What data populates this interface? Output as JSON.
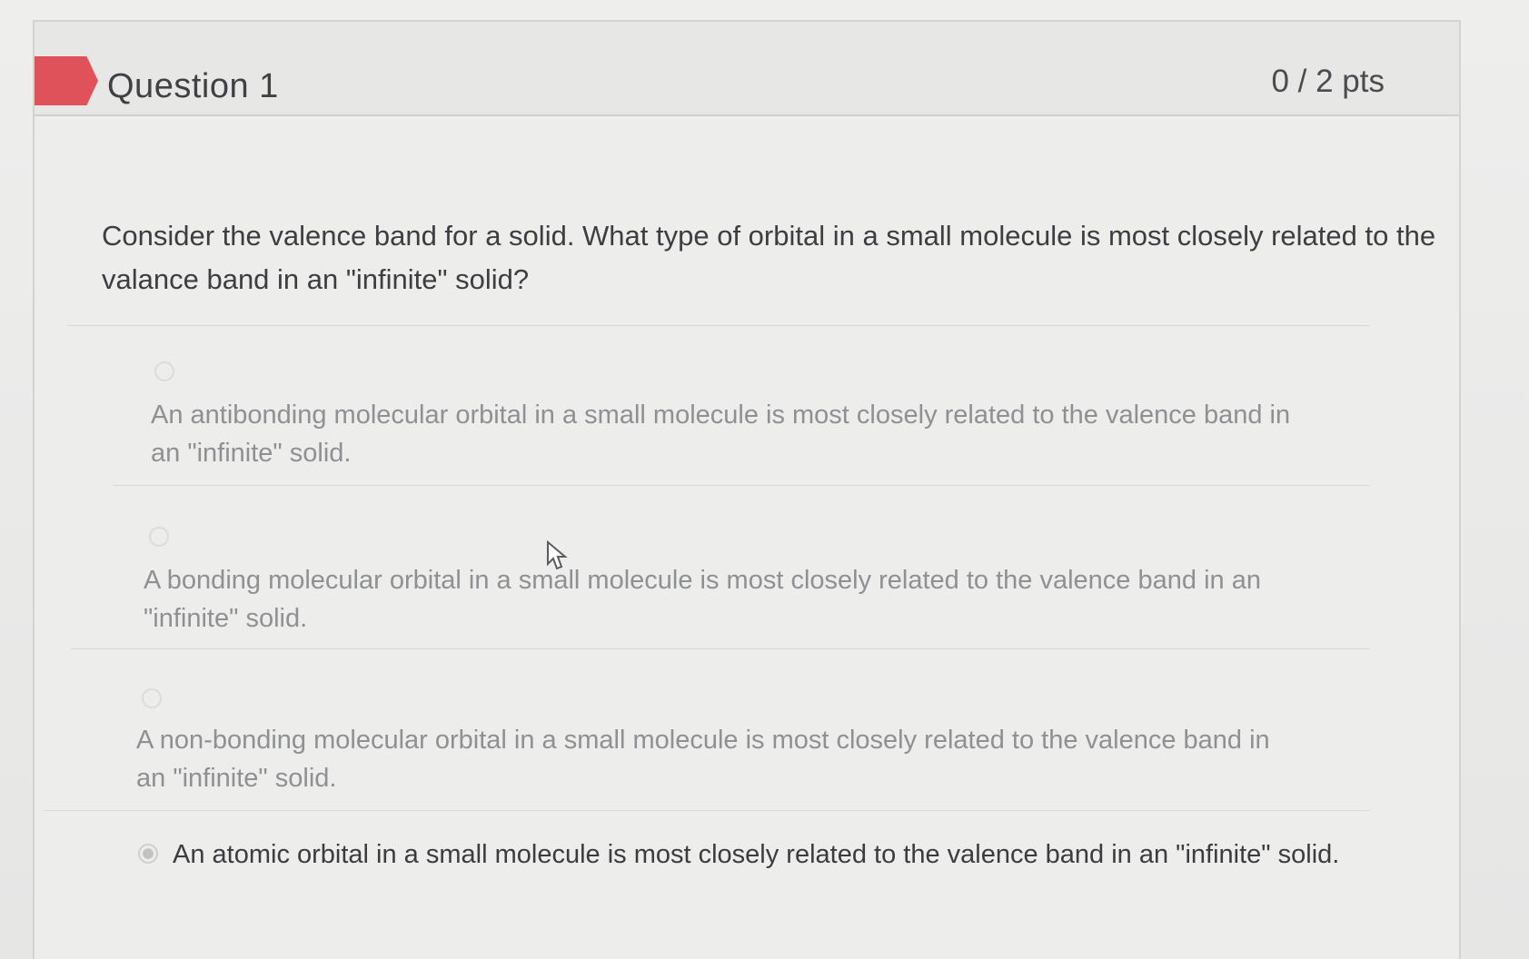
{
  "question": {
    "title": "Question 1",
    "points": "0 / 2 pts",
    "prompt": "Consider the valence band for a solid. What type of orbital in a small molecule is most closely related to the valance band in an \"infinite\" solid?"
  },
  "answers": [
    {
      "label": "An antibonding molecular orbital in a small molecule is most closely related to the valence band in an \"infinite\" solid.",
      "selected": false
    },
    {
      "label": "A bonding molecular orbital in a small molecule is most closely related to the valence band in an \"infinite\" solid.",
      "selected": false
    },
    {
      "label": "A non-bonding molecular orbital in a small molecule is most closely related to the valence band in an \"infinite\" solid.",
      "selected": false
    },
    {
      "label": "An atomic orbital in a small molecule is most closely related to the valence band in an \"infinite\" solid.",
      "selected": true
    }
  ],
  "colors": {
    "flag": "#e05259",
    "background": "#ededec",
    "header": "#e7e7e6",
    "question_text": "#3c3e41",
    "unselected_answer_text": "#8e9093"
  },
  "icons": {
    "flag": "question-flag-icon",
    "cursor": "mouse-pointer-icon"
  }
}
